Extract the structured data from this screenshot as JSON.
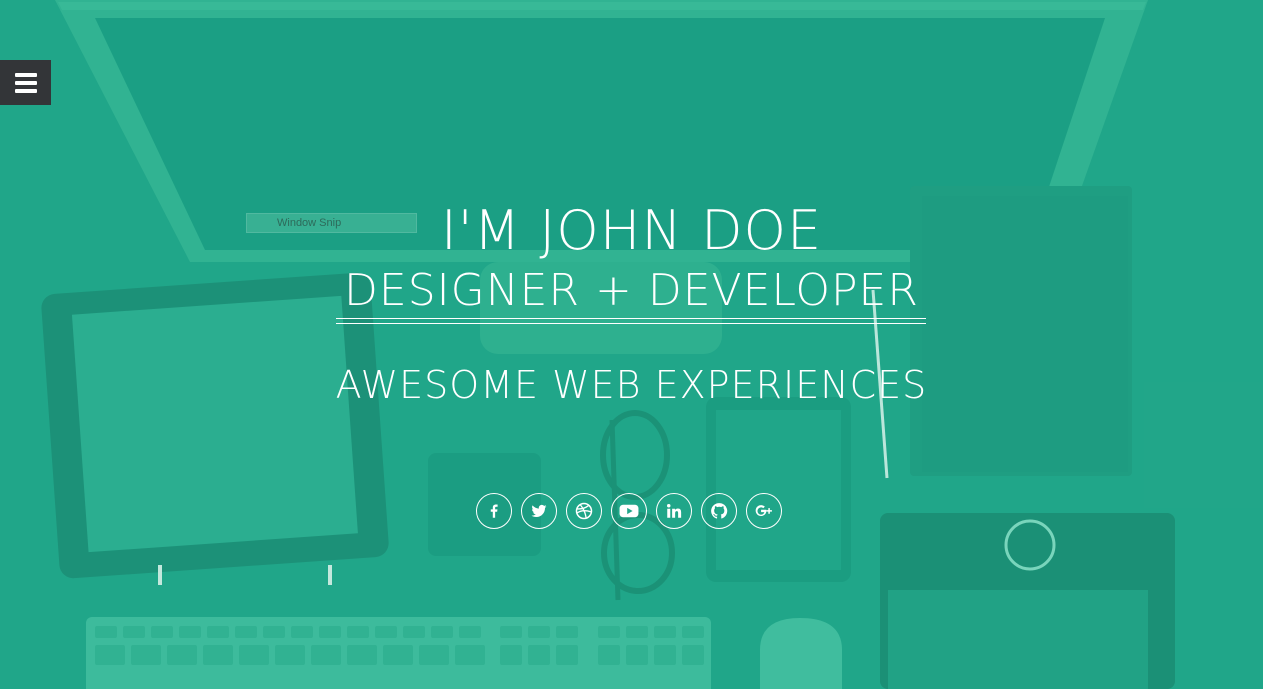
{
  "header": {
    "menu_icon": "hamburger-menu-icon"
  },
  "snip": {
    "label": "Window Snip"
  },
  "hero": {
    "title": "I'M JOHN DOE",
    "role": "DESIGNER + DEVELOPER",
    "tagline": "AWESOME WEB EXPERIENCES"
  },
  "social": [
    {
      "name": "facebook",
      "icon": "facebook-icon"
    },
    {
      "name": "twitter",
      "icon": "twitter-icon"
    },
    {
      "name": "dribbble",
      "icon": "dribbble-icon"
    },
    {
      "name": "youtube",
      "icon": "youtube-icon"
    },
    {
      "name": "linkedin",
      "icon": "linkedin-icon"
    },
    {
      "name": "github",
      "icon": "github-icon"
    },
    {
      "name": "google-plus",
      "icon": "google-plus-icon"
    }
  ],
  "colors": {
    "background": "#22a68a",
    "menu_button": "#333538",
    "text": "#ffffff"
  }
}
